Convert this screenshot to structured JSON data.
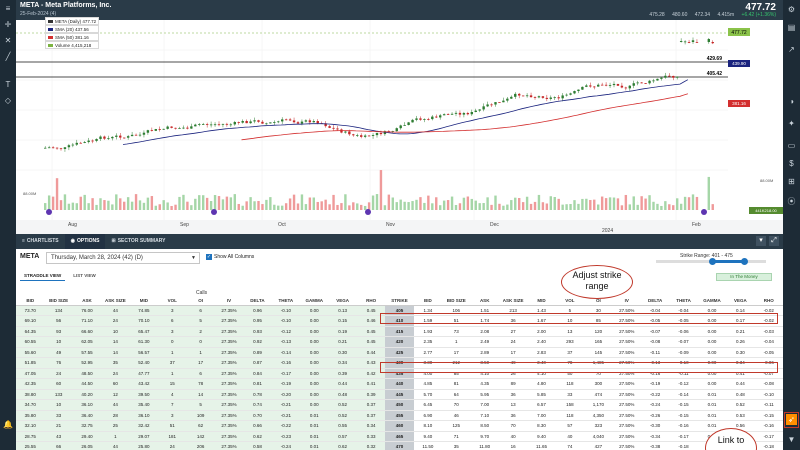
{
  "header": {
    "title": "META - Meta Platforms, Inc.",
    "date": "25-Feb-2024 (4)",
    "price": "477.72",
    "open": "475.28",
    "high": "480.60",
    "low": "472.34",
    "volume": "4.415m",
    "change": "+6.42 (+1.36%)"
  },
  "legend": [
    {
      "label": "META (Daily) 477.72",
      "color": "#333333"
    },
    {
      "label": "SMA (20) 437.56",
      "color": "#1a237e"
    },
    {
      "label": "SMA (50) 381.16",
      "color": "#d32f2f"
    },
    {
      "label": "Volume 4,415,218",
      "color": "#7cb342"
    }
  ],
  "price_tags": {
    "last": "477.72",
    "line1": "429.69",
    "line2": "405.42",
    "sma20": "439.90",
    "sma50": "381.16",
    "vol": "441K218.00",
    "level_88": "88.00M",
    "level_0": "0.00"
  },
  "axis_months": [
    "Aug",
    "Sep",
    "Oct",
    "Nov",
    "Dec",
    "Feb"
  ],
  "axis_year": "2024",
  "tabs": {
    "charts": "CHARTLISTS",
    "options": "OPTIONS",
    "sector": "SECTOR SUMMARY"
  },
  "options": {
    "symbol": "META",
    "expiry": "Thursday, March 28, 2024 (42) (D)",
    "show_all": "Show All Columns",
    "strike_range_label": "Strike Range: 401 - 475",
    "view_straddle": "STRADDLE VIEW",
    "view_list": "LIST VIEW",
    "in_the_money": "In The Money",
    "calls_label": "Calls",
    "puts_label": "Puts"
  },
  "columns": [
    "BID",
    "BID SIZE",
    "ASK",
    "ASK SIZE",
    "MID",
    "VOL",
    "OI",
    "IV",
    "DELTA",
    "THETA",
    "GAMMA",
    "VEGA",
    "RHO",
    "STRIKE",
    "BID",
    "BID SIZE",
    "ASK",
    "ASK SIZE",
    "MID",
    "VOL",
    "OI",
    "IV",
    "DELTA",
    "THETA",
    "GAMMA",
    "VEGA",
    "RHO"
  ],
  "rows": [
    [
      "73.70",
      "134",
      "76.00",
      "44",
      "74.85",
      "3",
      "6",
      "27.35%",
      "0.96",
      "-0.10",
      "0.00",
      "0.13",
      "0.45",
      "405",
      "1.34",
      "106",
      "1.51",
      "213",
      "1.43",
      "5",
      "30",
      "27.50%",
      "-0.04",
      "-0.04",
      "0.00",
      "0.14",
      "-0.02"
    ],
    [
      "69.10",
      "56",
      "71.10",
      "24",
      "70.10",
      "6",
      "5",
      "27.35%",
      "0.95",
      "-0.10",
      "0.00",
      "0.15",
      "0.46",
      "410",
      "1.59",
      "51",
      "1.74",
      "36",
      "1.67",
      "10",
      "85",
      "27.50%",
      "-0.05",
      "-0.05",
      "0.00",
      "0.17",
      "-0.02"
    ],
    [
      "64.35",
      "93",
      "66.60",
      "10",
      "65.47",
      "3",
      "2",
      "27.35%",
      "0.93",
      "-0.12",
      "0.00",
      "0.19",
      "0.45",
      "415",
      "1.93",
      "73",
      "2.08",
      "27",
      "2.00",
      "13",
      "120",
      "27.50%",
      "-0.07",
      "-0.06",
      "0.00",
      "0.21",
      "-0.03"
    ],
    [
      "60.55",
      "10",
      "62.05",
      "14",
      "61.30",
      "0",
      "0",
      "27.35%",
      "0.92",
      "-0.13",
      "0.00",
      "0.21",
      "0.45",
      "420",
      "2.35",
      "1",
      "2.49",
      "24",
      "2.40",
      "293",
      "165",
      "27.50%",
      "-0.08",
      "-0.07",
      "0.00",
      "0.26",
      "-0.04"
    ],
    [
      "55.60",
      "49",
      "57.55",
      "14",
      "56.57",
      "1",
      "1",
      "27.35%",
      "0.89",
      "-0.14",
      "0.00",
      "0.30",
      "0.44",
      "425",
      "2.77",
      "17",
      "2.89",
      "17",
      "2.83",
      "37",
      "145",
      "27.50%",
      "-0.11",
      "-0.09",
      "0.00",
      "0.30",
      "-0.05"
    ],
    [
      "51.85",
      "76",
      "52.95",
      "35",
      "52.40",
      "37",
      "17",
      "27.35%",
      "0.87",
      "-0.16",
      "0.00",
      "0.34",
      "0.43",
      "430",
      "3.30",
      "212",
      "3.50",
      "49",
      "3.40",
      "78",
      "1,485",
      "27.50%",
      "-0.13",
      "-0.10",
      "0.00",
      "0.34",
      "-0.06"
    ],
    [
      "47.05",
      "24",
      "48.50",
      "24",
      "47.77",
      "1",
      "6",
      "27.35%",
      "0.84",
      "-0.17",
      "0.00",
      "0.39",
      "0.42",
      "435",
      "4.00",
      "85",
      "4.10",
      "26",
      "4.10",
      "50",
      "70",
      "27.50%",
      "-0.16",
      "-0.11",
      "0.00",
      "0.41",
      "-0.07"
    ],
    [
      "42.35",
      "60",
      "44.50",
      "60",
      "43.42",
      "15",
      "78",
      "27.35%",
      "0.81",
      "-0.19",
      "0.00",
      "0.44",
      "0.41",
      "440",
      "4.85",
      "81",
      "4.35",
      "89",
      "4.80",
      "118",
      "300",
      "27.50%",
      "-0.19",
      "-0.12",
      "0.00",
      "0.44",
      "-0.08"
    ],
    [
      "38.80",
      "133",
      "40.20",
      "12",
      "39.50",
      "4",
      "14",
      "27.35%",
      "0.78",
      "-0.20",
      "0.00",
      "0.48",
      "0.39",
      "445",
      "5.70",
      "64",
      "5.95",
      "36",
      "5.85",
      "33",
      "474",
      "27.50%",
      "-0.22",
      "-0.14",
      "0.01",
      "0.48",
      "-0.10"
    ],
    [
      "34.70",
      "10",
      "36.10",
      "44",
      "35.40",
      "7",
      "5",
      "27.35%",
      "0.74",
      "-0.21",
      "0.00",
      "0.52",
      "0.37",
      "450",
      "6.45",
      "70",
      "7.00",
      "13",
      "6.57",
      "158",
      "1,170",
      "27.50%",
      "-0.24",
      "-0.15",
      "0.01",
      "0.52",
      "-0.11"
    ],
    [
      "35.80",
      "33",
      "36.40",
      "28",
      "36.10",
      "3",
      "109",
      "27.35%",
      "0.70",
      "-0.21",
      "0.01",
      "0.52",
      "0.37",
      "455",
      "6.90",
      "46",
      "7.10",
      "36",
      "7.00",
      "118",
      "4,350",
      "27.50%",
      "-0.26",
      "-0.15",
      "0.01",
      "0.53",
      "-0.15"
    ],
    [
      "32.10",
      "21",
      "32.75",
      "25",
      "32.42",
      "51",
      "62",
      "27.35%",
      "0.66",
      "-0.22",
      "0.01",
      "0.55",
      "0.34",
      "460",
      "8.10",
      "125",
      "8.50",
      "70",
      "8.30",
      "57",
      "323",
      "27.50%",
      "-0.30",
      "-0.16",
      "0.01",
      "0.56",
      "-0.16"
    ],
    [
      "28.75",
      "43",
      "29.40",
      "1",
      "29.07",
      "181",
      "142",
      "27.35%",
      "0.62",
      "-0.23",
      "0.01",
      "0.57",
      "0.33",
      "465",
      "9.40",
      "71",
      "9.70",
      "40",
      "9.40",
      "40",
      "4,040",
      "27.50%",
      "-0.34",
      "-0.17",
      "0.01",
      "0.58",
      "-0.17"
    ],
    [
      "25.55",
      "66",
      "26.05",
      "44",
      "25.80",
      "24",
      "206",
      "27.35%",
      "0.58",
      "-0.24",
      "0.01",
      "0.62",
      "0.32",
      "470",
      "11.50",
      "35",
      "11.80",
      "16",
      "11.65",
      "74",
      "427",
      "27.50%",
      "-0.38",
      "-0.18",
      "0.01",
      "0.60",
      "-0.18"
    ],
    [
      "22.00",
      "45",
      "22.85",
      "30",
      "22.42",
      "5",
      "70",
      "27.35%",
      "0.55",
      "-0.24",
      "0.01",
      "0.60",
      "0.30",
      "475",
      "12.80",
      "24",
      "13.10",
      "28",
      "12.95",
      "78",
      "85",
      "27.50%",
      "-0.41",
      "-0.19",
      "0.01",
      "0.61",
      "-0.19"
    ]
  ],
  "annotations": {
    "strike": "Adjust strike range",
    "link": "Link to"
  },
  "chart_data": {
    "type": "line",
    "series": [
      {
        "name": "META (Daily)"
      },
      {
        "name": "SMA (20)"
      },
      {
        "name": "SMA (50)"
      },
      {
        "name": "Volume"
      }
    ],
    "ylim": [
      230,
      490
    ],
    "x": [
      "Aug",
      "Sep",
      "Oct",
      "Nov",
      "Dec",
      "Feb"
    ]
  }
}
